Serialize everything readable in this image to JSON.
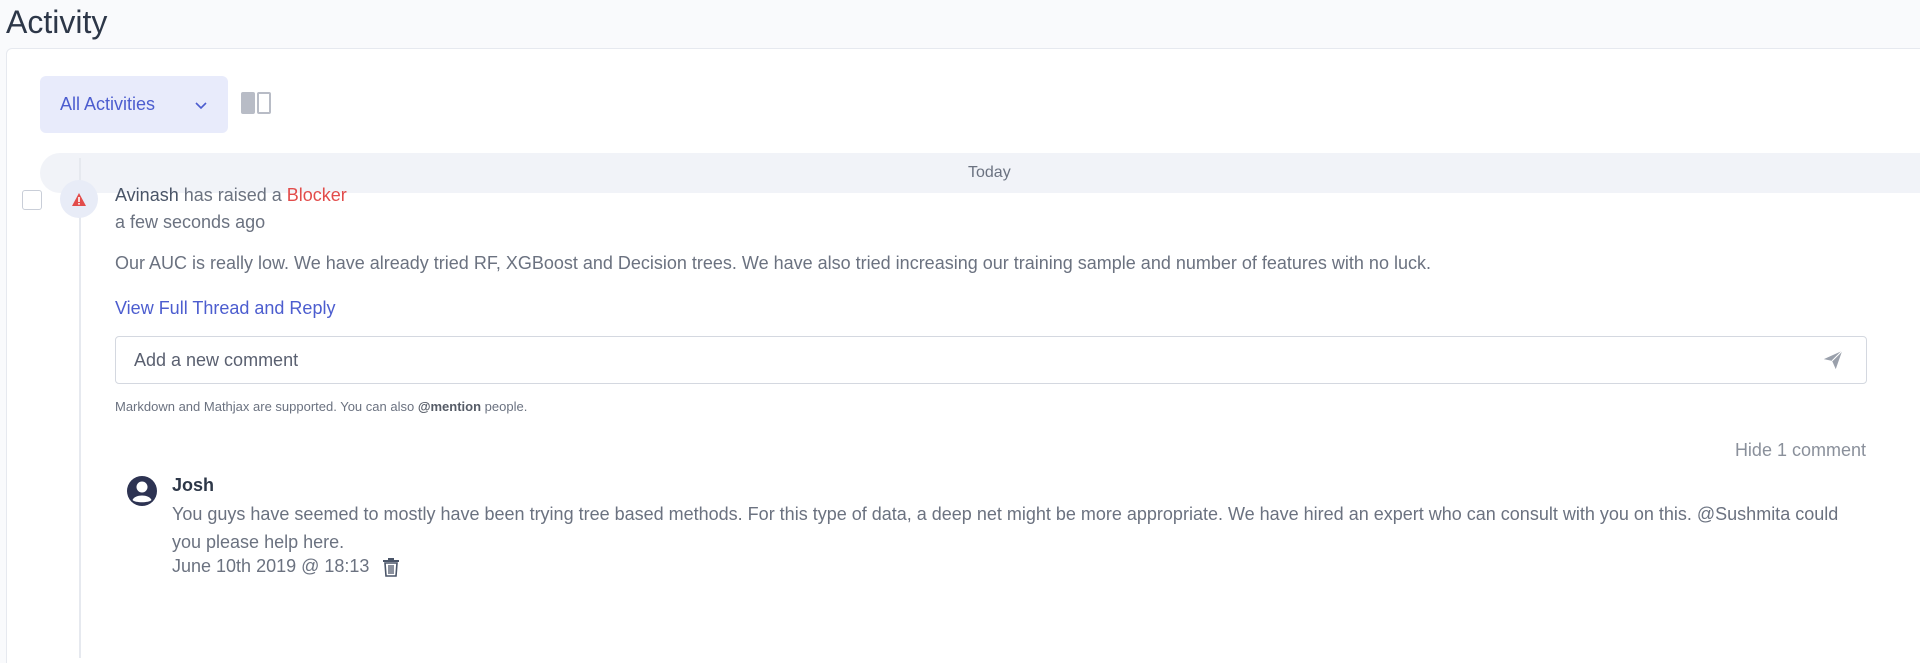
{
  "page": {
    "title": "Activity"
  },
  "toolbar": {
    "filter_label": "All Activities",
    "filter_icon": "chevron-down-icon",
    "layout_icon": "split-view-icon"
  },
  "timeline": {
    "group_label": "Today"
  },
  "event": {
    "actor": "Avinash",
    "action_text": " has raised a ",
    "type_label": "Blocker",
    "type_color": "#e24c4b",
    "time": "a few seconds ago",
    "body": "Our AUC is really low. We have already tried RF, XGBoost and Decision trees. We have also tried increasing our training sample and number of features with no luck.",
    "thread_link": "View Full Thread and Reply"
  },
  "comment_form": {
    "placeholder": "Add a new comment",
    "hint_prefix": "Markdown and Mathjax are supported. You can also ",
    "hint_mention": "@mention",
    "hint_suffix": " people."
  },
  "comments": {
    "toggle_label": "Hide 1 comment",
    "items": [
      {
        "author": "Josh",
        "text": "You guys have seemed to mostly have been trying tree based methods. For this type of data, a deep net might be more appropriate. We have hired an expert who can consult with you on this. @Sushmita could you please help here.",
        "date": "June 10th 2019 @ 18:13"
      }
    ]
  },
  "colors": {
    "accent": "#4c5dcf",
    "filter_bg": "#e8ebfb",
    "blocker": "#e24c4b"
  }
}
